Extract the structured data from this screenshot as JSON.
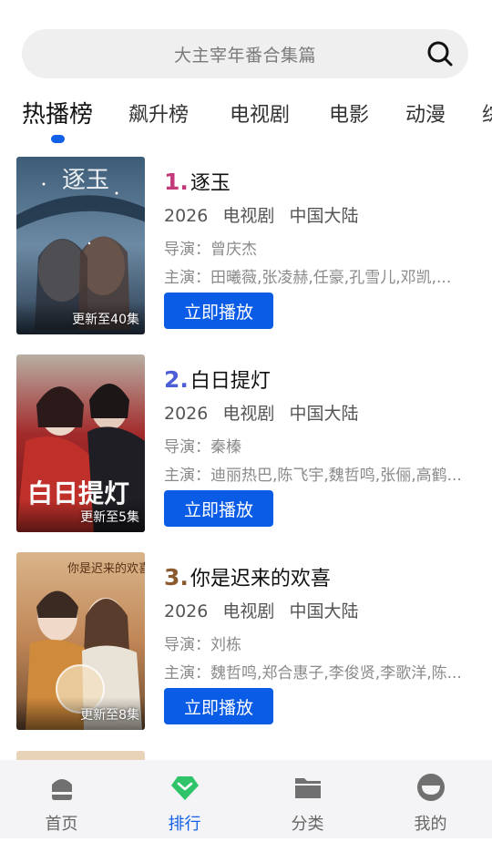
{
  "search": {
    "placeholder": "大主宰年番合集篇",
    "icon": "search-icon"
  },
  "tabs": [
    {
      "label": "热播榜",
      "active": true
    },
    {
      "label": "飙升榜",
      "active": false
    },
    {
      "label": "电视剧",
      "active": false
    },
    {
      "label": "电影",
      "active": false
    },
    {
      "label": "动漫",
      "active": false
    },
    {
      "label": "综",
      "active": false
    }
  ],
  "items": [
    {
      "rank": "1.",
      "rank_color": "#c23a7a",
      "title": "逐玉",
      "year": "2026",
      "genre": "电视剧",
      "region": "中国大陆",
      "director": "导演：曾庆杰",
      "cast": "主演：田曦薇,张凌赫,任豪,孔雪儿,邓凯,...",
      "badge": "更新至40集",
      "poster_title": "逐玉",
      "play_label": "立即播放"
    },
    {
      "rank": "2.",
      "rank_color": "#4d5fd6",
      "title": "白日提灯",
      "year": "2026",
      "genre": "电视剧",
      "region": "中国大陆",
      "director": "导演：秦榛",
      "cast": "主演：迪丽热巴,陈飞宇,魏哲鸣,张俪,高鹤...",
      "badge": "更新至5集",
      "poster_title": "白日提灯",
      "play_label": "立即播放"
    },
    {
      "rank": "3.",
      "rank_color": "#8a5a2e",
      "title": "你是迟来的欢喜",
      "year": "2026",
      "genre": "电视剧",
      "region": "中国大陆",
      "director": "导演：刘栋",
      "cast": "主演：魏哲鸣,郑合惠子,李俊贤,李歌洋,陈...",
      "badge": "更新至8集",
      "poster_title": "你是迟来的欢喜",
      "play_label": "立即播放"
    }
  ],
  "bottom_nav": [
    {
      "label": "首页",
      "icon": "home-icon",
      "active": false
    },
    {
      "label": "排行",
      "icon": "ranking-icon",
      "active": true
    },
    {
      "label": "分类",
      "icon": "folder-icon",
      "active": false
    },
    {
      "label": "我的",
      "icon": "profile-icon",
      "active": false
    }
  ],
  "colors": {
    "accent": "#1260e8",
    "button": "#0a5ce6"
  }
}
